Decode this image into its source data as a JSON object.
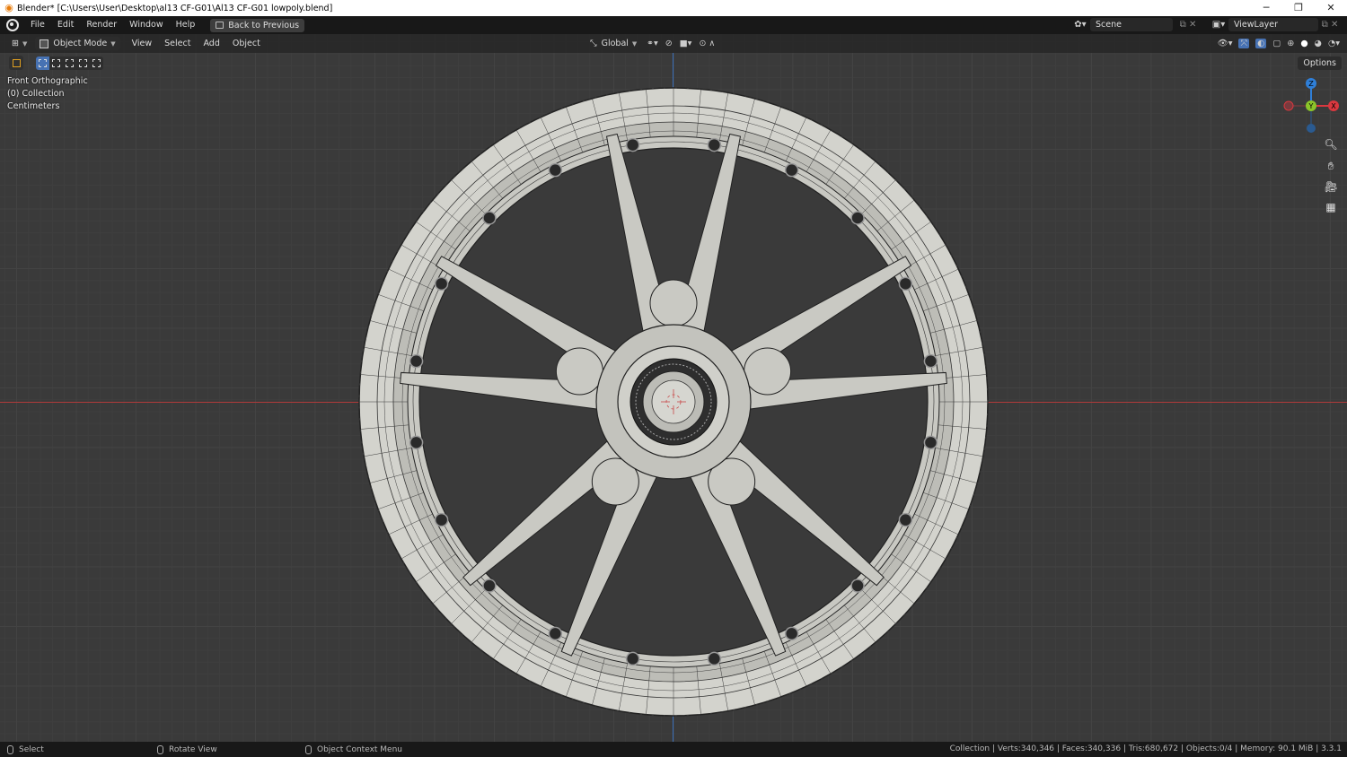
{
  "window": {
    "title": "Blender* [C:\\Users\\User\\Desktop\\al13 CF-G01\\Al13 CF-G01 lowpoly.blend]",
    "controls": [
      "─",
      "❐",
      "✕"
    ]
  },
  "topbar": {
    "menus": [
      "File",
      "Edit",
      "Render",
      "Window",
      "Help"
    ],
    "back_button": "Back to Previous",
    "scene": "Scene",
    "view_layer": "ViewLayer"
  },
  "header3d": {
    "mode": "Object Mode",
    "menus": [
      "View",
      "Select",
      "Add",
      "Object"
    ],
    "orientation": "Global",
    "options": "Options"
  },
  "viewport": {
    "view_name": "Front Orthographic",
    "collection": "(0) Collection",
    "units": "Centimeters",
    "gizmo": {
      "z": "Z",
      "y": "Y",
      "x": "X"
    },
    "colors": {
      "x_axis": "#d9383f",
      "y_axis": "#8bc529",
      "z_axis": "#2f7fd8",
      "background": "#3a3a3a",
      "mesh": "#d0d0ca",
      "selection": "#4772b3"
    }
  },
  "statusbar": {
    "select": "Select",
    "rotate": "Rotate View",
    "context": "Object Context Menu",
    "stats": "Collection | Verts:340,346 | Faces:340,336 | Tris:680,672 | Objects:0/4 | Memory: 90.1 MiB | 3.3.1"
  }
}
